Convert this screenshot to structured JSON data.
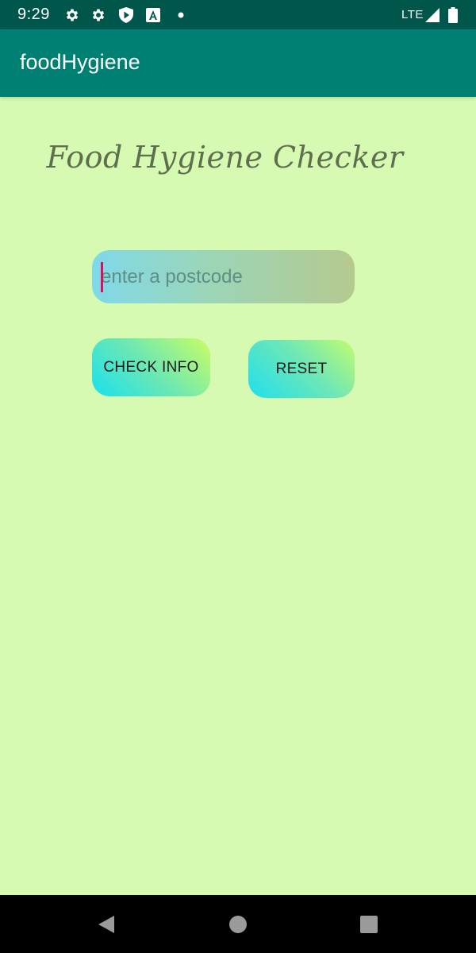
{
  "status_bar": {
    "time": "9:29",
    "network": "LTE",
    "icons": [
      "gear-icon",
      "gear-icon",
      "shield-play-icon",
      "a-box-icon",
      "dot-icon",
      "signal-icon",
      "battery-icon"
    ]
  },
  "app_bar": {
    "title": "foodHygiene"
  },
  "main": {
    "heading": "Food Hygiene Checker",
    "postcode_placeholder": "enter a postcode",
    "postcode_value": "",
    "check_label": "CHECK INFO",
    "reset_label": "RESET"
  },
  "nav_bar": {
    "icons": [
      "back-icon",
      "home-icon",
      "recents-icon"
    ]
  },
  "colors": {
    "background": "#d6fab1",
    "status_bar": "#00564b",
    "app_bar": "#008073",
    "heading": "#5f6e4f",
    "cursor": "#d8125e"
  }
}
